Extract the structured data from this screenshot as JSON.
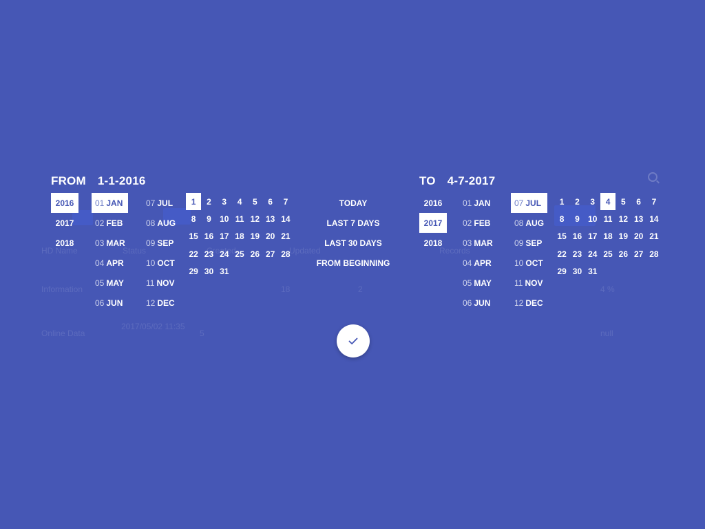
{
  "background_table": {
    "header_cells": [
      "HD Name",
      "Status",
      "Created",
      "Updated",
      "Records"
    ],
    "rows": [
      [
        "Information",
        "18",
        "",
        "2",
        "4 %"
      ],
      [
        "Online Data",
        "2017/05/02 11:35",
        "5",
        "",
        "null"
      ]
    ]
  },
  "from": {
    "label": "FROM",
    "date": "1-1-2016",
    "years": [
      "2016",
      "2017",
      "2018"
    ],
    "selected_year": "2016",
    "months_col1": [
      {
        "num": "01",
        "name": "JAN"
      },
      {
        "num": "02",
        "name": "FEB"
      },
      {
        "num": "03",
        "name": "MAR"
      },
      {
        "num": "04",
        "name": "APR"
      },
      {
        "num": "05",
        "name": "MAY"
      },
      {
        "num": "06",
        "name": "JUN"
      }
    ],
    "months_col2": [
      {
        "num": "07",
        "name": "JUL"
      },
      {
        "num": "08",
        "name": "AUG"
      },
      {
        "num": "09",
        "name": "SEP"
      },
      {
        "num": "10",
        "name": "OCT"
      },
      {
        "num": "11",
        "name": "NOV"
      },
      {
        "num": "12",
        "name": "DEC"
      }
    ],
    "selected_month": "01",
    "selected_day": 1,
    "days_in_month": 31
  },
  "to": {
    "label": "TO",
    "date": "4-7-2017",
    "years": [
      "2016",
      "2017",
      "2018"
    ],
    "selected_year": "2017",
    "months_col1": [
      {
        "num": "01",
        "name": "JAN"
      },
      {
        "num": "02",
        "name": "FEB"
      },
      {
        "num": "03",
        "name": "MAR"
      },
      {
        "num": "04",
        "name": "APR"
      },
      {
        "num": "05",
        "name": "MAY"
      },
      {
        "num": "06",
        "name": "JUN"
      }
    ],
    "months_col2": [
      {
        "num": "07",
        "name": "JUL"
      },
      {
        "num": "08",
        "name": "AUG"
      },
      {
        "num": "09",
        "name": "SEP"
      },
      {
        "num": "10",
        "name": "OCT"
      },
      {
        "num": "11",
        "name": "NOV"
      },
      {
        "num": "12",
        "name": "DEC"
      }
    ],
    "selected_month": "07",
    "selected_day": 4,
    "days_in_month": 31
  },
  "quick_ranges": [
    "TODAY",
    "LAST 7 DAYS",
    "LAST 30 DAYS",
    "FROM BEGINNING"
  ],
  "confirm_icon": "check-icon",
  "colors": {
    "background": "#4657b5",
    "accent": "#4657b5",
    "foreground": "#ffffff"
  }
}
